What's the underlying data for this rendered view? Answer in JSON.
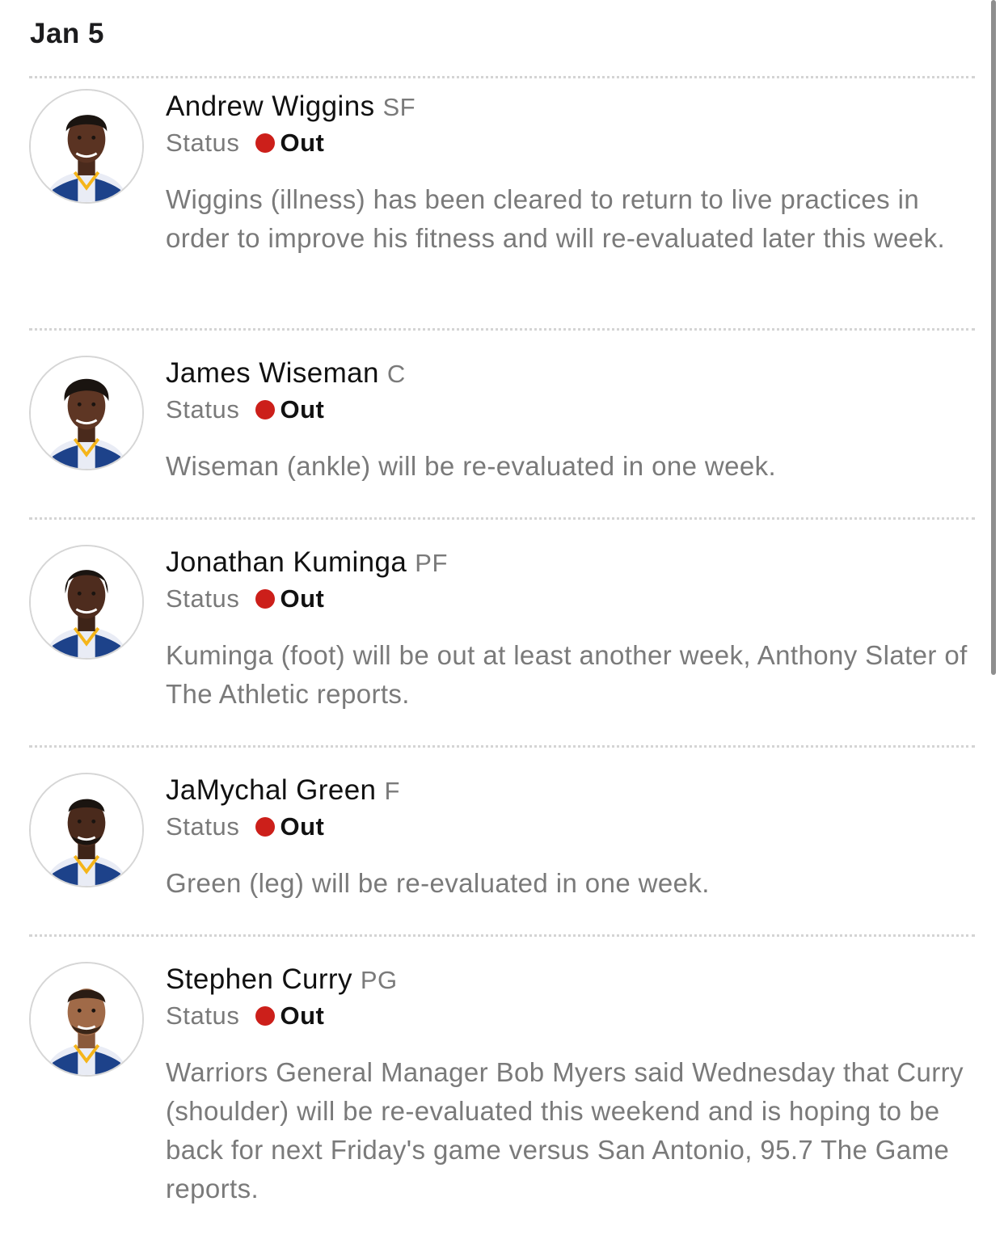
{
  "header": {
    "date": "Jan 5"
  },
  "colors": {
    "status_out": "#cc1f1a"
  },
  "entries": [
    {
      "avatar_icon": "player-headshot-icon",
      "name": "Andrew Wiggins",
      "position": "SF",
      "status_label": "Status",
      "status": "Out",
      "note": "Wiggins (illness) has been cleared to return to live practices in order to improve his fitness and will re-evaluated later this week."
    },
    {
      "avatar_icon": "player-headshot-icon",
      "name": "James Wiseman",
      "position": "C",
      "status_label": "Status",
      "status": "Out",
      "note": "Wiseman (ankle) will be re-evaluated in one week."
    },
    {
      "avatar_icon": "player-headshot-icon",
      "name": "Jonathan Kuminga",
      "position": "PF",
      "status_label": "Status",
      "status": "Out",
      "note": "Kuminga (foot) will be out at least another week, Anthony Slater of The Athletic reports."
    },
    {
      "avatar_icon": "player-headshot-icon",
      "name": "JaMychal Green",
      "position": "F",
      "status_label": "Status",
      "status": "Out",
      "note": "Green (leg) will be re-evaluated in one week."
    },
    {
      "avatar_icon": "player-headshot-icon",
      "name": "Stephen Curry",
      "position": "PG",
      "status_label": "Status",
      "status": "Out",
      "note": "Warriors General Manager Bob Myers said Wednesday that Curry (shoulder) will be re-evaluated this weekend and is hoping to be back for next Friday's game versus San Antonio, 95.7 The Game reports."
    }
  ]
}
